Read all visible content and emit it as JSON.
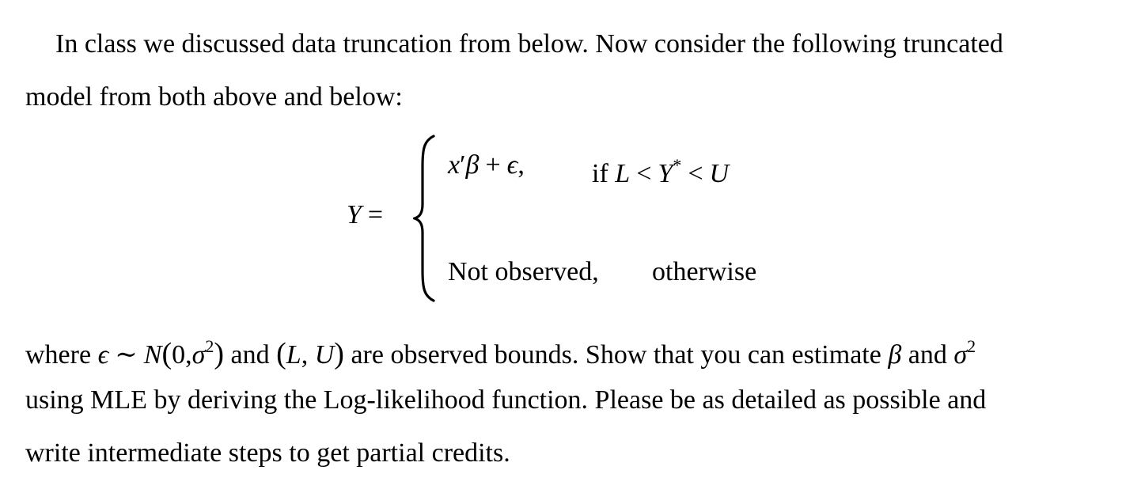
{
  "paragraph1": {
    "line1": "In class we discussed data truncation from below. Now consider the following truncated",
    "line2": "model from both above and below:"
  },
  "equation": {
    "lhs_var": "Y",
    "equals": "=",
    "case1": {
      "x": "x",
      "prime": "′",
      "beta": "β",
      "plus": "+",
      "eps": "ϵ",
      "comma": ",",
      "if_word": "if",
      "L": "L",
      "lt1": "<",
      "Ystar": "Y",
      "star": "*",
      "lt2": "<",
      "U": "U"
    },
    "case2": {
      "expr": "Not observed,",
      "cond": "otherwise"
    }
  },
  "paragraph2": {
    "where": "where",
    "eps": "ϵ",
    "tilde": "∼",
    "N": "N",
    "open_paren": "(",
    "zero_comma": "0,",
    "sigma": "σ",
    "sq": "2",
    "close_paren": ")",
    "and1": "and",
    "L": "L",
    "comma": ",",
    "U": "U",
    "rest1": "are observed bounds. Show that you can estimate",
    "beta": "β",
    "and2": "and",
    "sigma2": "σ",
    "sq2": "2",
    "line2": "using MLE by deriving the Log-likelihood function. Please be as detailed as possible and",
    "line3": "write intermediate steps to get partial credits."
  }
}
